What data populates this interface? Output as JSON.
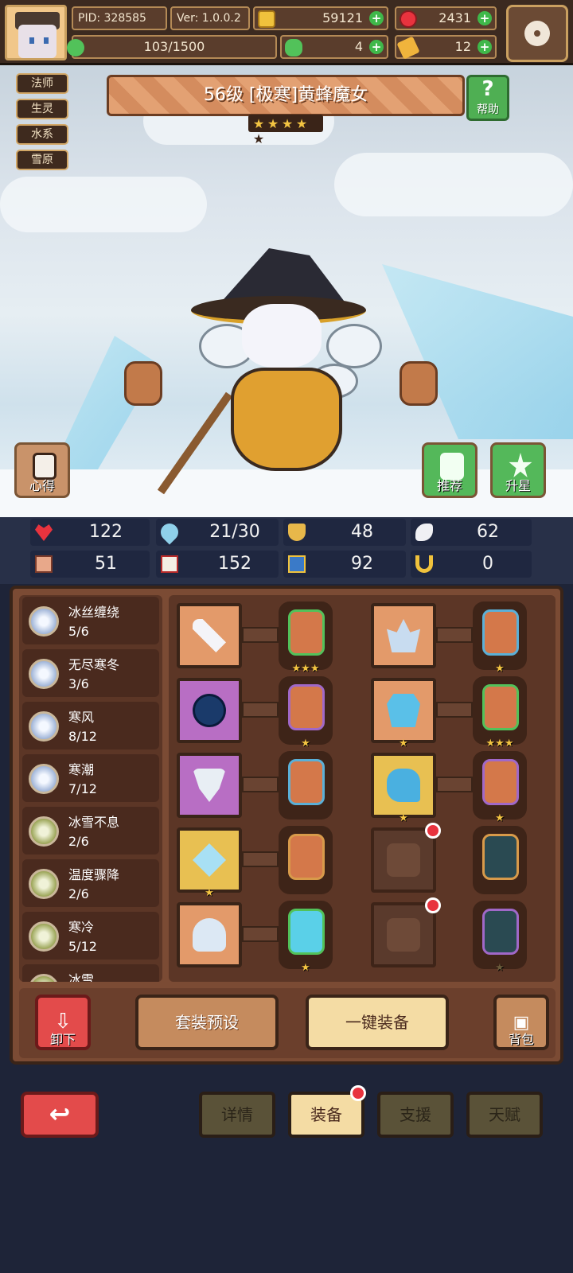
{
  "header": {
    "pid": "PID: 328585",
    "version": "Ver: 1.0.0.2",
    "gold": "59121",
    "gems": "2431",
    "exp": "103/1500",
    "clover": "4",
    "keys": "12"
  },
  "tags": [
    "法师",
    "生灵",
    "水系",
    "雪原"
  ],
  "hero": {
    "title": "56级 [极寒]黄蜂魔女",
    "stars_filled": 4,
    "stars_total": 5,
    "star_glyph": "★"
  },
  "buttons": {
    "help": "帮助",
    "experience": "心得",
    "recommend": "推荐",
    "star_up": "升星",
    "unload": "卸下",
    "preset": "套装预设",
    "one_click": "一键装备",
    "bag": "背包"
  },
  "stats": [
    {
      "icon": "heart-icon",
      "value": "122"
    },
    {
      "icon": "drop-icon",
      "value": "21/30"
    },
    {
      "icon": "shield-icon",
      "value": "48"
    },
    {
      "icon": "wing-icon",
      "value": "62"
    },
    {
      "icon": "fist-icon",
      "value": "51"
    },
    {
      "icon": "book-icon",
      "value": "152"
    },
    {
      "icon": "boot-icon",
      "value": "92"
    },
    {
      "icon": "horseshoe-icon",
      "value": "0"
    }
  ],
  "sets": [
    {
      "name": "冰丝缠绕",
      "count": "5/6",
      "type": "blue"
    },
    {
      "name": "无尽寒冬",
      "count": "3/6",
      "type": "blue"
    },
    {
      "name": "寒风",
      "count": "8/12",
      "type": "blue"
    },
    {
      "name": "寒潮",
      "count": "7/12",
      "type": "blue"
    },
    {
      "name": "冰雪不息",
      "count": "2/6",
      "type": "green"
    },
    {
      "name": "温度骤降",
      "count": "2/6",
      "type": "green"
    },
    {
      "name": "寒冷",
      "count": "5/12",
      "type": "green"
    },
    {
      "name": "冰雪",
      "count": "",
      "type": "green"
    }
  ],
  "nav": {
    "back": "↩",
    "details": "详情",
    "equip": "装备",
    "support": "支援",
    "talent": "天赋"
  },
  "colors": {
    "accent": "#e8c052",
    "danger": "#e34b4b",
    "positive": "#54b85a"
  }
}
